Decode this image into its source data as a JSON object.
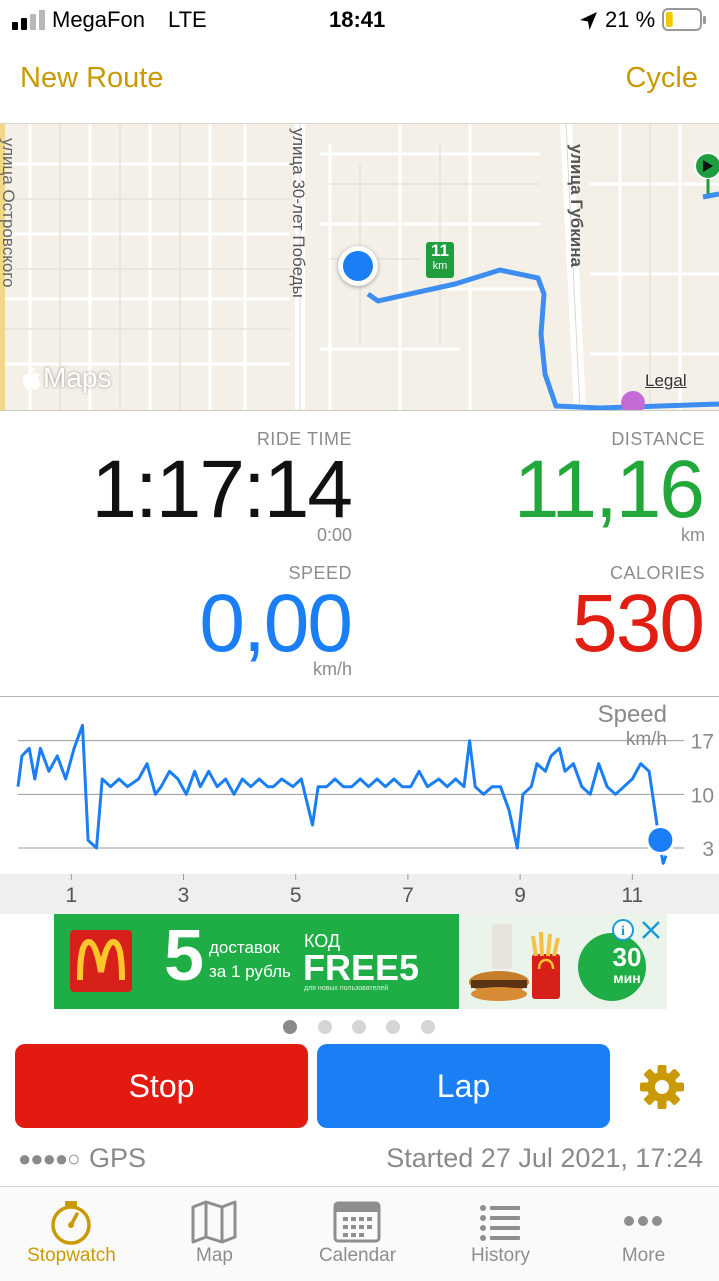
{
  "status_bar": {
    "carrier": "MegaFon",
    "network": "LTE",
    "time": "18:41",
    "battery_percent": "21 %",
    "battery_level": 0.21
  },
  "nav": {
    "left_label": "New Route",
    "right_label": "Cycle"
  },
  "map": {
    "street_labels": [
      "улица 30-лет Победы",
      "улица Губкина",
      "улица Островского"
    ],
    "km_marker": "11",
    "km_marker_unit": "km",
    "brand": "Maps",
    "legal": "Legal"
  },
  "stats": {
    "ride_time_label": "RIDE TIME",
    "ride_time_value": "1:17:14",
    "ride_time_sub": "0:00",
    "distance_label": "DISTANCE",
    "distance_value": "11,16",
    "distance_unit": "km",
    "speed_label": "SPEED",
    "speed_value": "0,00",
    "speed_unit": "km/h",
    "calories_label": "CALORIES",
    "calories_value": "530"
  },
  "chart_data": {
    "type": "line",
    "title": "Speed",
    "ylabel": "km/h",
    "yticks": [
      17,
      10,
      3
    ],
    "ylim": [
      0,
      21
    ],
    "xticks": [
      1,
      3,
      5,
      7,
      9,
      11
    ],
    "xlim": [
      0.05,
      11.85
    ],
    "grid": true,
    "series": [
      {
        "values": [
          [
            0.05,
            11
          ],
          [
            0.12,
            15
          ],
          [
            0.25,
            16
          ],
          [
            0.35,
            12
          ],
          [
            0.45,
            16
          ],
          [
            0.6,
            13
          ],
          [
            0.75,
            15
          ],
          [
            0.9,
            12
          ],
          [
            1.05,
            16
          ],
          [
            1.2,
            19
          ],
          [
            1.3,
            4
          ],
          [
            1.45,
            3
          ],
          [
            1.55,
            12
          ],
          [
            1.7,
            11
          ],
          [
            1.85,
            12
          ],
          [
            2.0,
            11
          ],
          [
            2.2,
            12
          ],
          [
            2.35,
            14
          ],
          [
            2.5,
            10
          ],
          [
            2.6,
            11
          ],
          [
            2.75,
            13
          ],
          [
            2.9,
            12
          ],
          [
            3.05,
            10
          ],
          [
            3.2,
            13
          ],
          [
            3.3,
            11
          ],
          [
            3.45,
            13
          ],
          [
            3.6,
            11
          ],
          [
            3.75,
            12
          ],
          [
            3.9,
            10
          ],
          [
            4.05,
            12
          ],
          [
            4.2,
            11
          ],
          [
            4.35,
            12
          ],
          [
            4.5,
            11
          ],
          [
            4.6,
            11
          ],
          [
            4.75,
            12
          ],
          [
            4.95,
            11
          ],
          [
            5.1,
            12
          ],
          [
            5.3,
            6
          ],
          [
            5.4,
            11
          ],
          [
            5.55,
            11
          ],
          [
            5.7,
            12
          ],
          [
            5.85,
            11
          ],
          [
            6.0,
            11
          ],
          [
            6.15,
            12
          ],
          [
            6.3,
            11
          ],
          [
            6.45,
            12
          ],
          [
            6.6,
            11
          ],
          [
            6.75,
            12
          ],
          [
            6.9,
            11
          ],
          [
            7.05,
            11
          ],
          [
            7.2,
            13
          ],
          [
            7.35,
            11
          ],
          [
            7.55,
            12
          ],
          [
            7.7,
            11
          ],
          [
            7.85,
            12
          ],
          [
            8.0,
            11
          ],
          [
            8.1,
            17
          ],
          [
            8.2,
            11
          ],
          [
            8.35,
            10
          ],
          [
            8.5,
            11
          ],
          [
            8.65,
            11
          ],
          [
            8.8,
            8
          ],
          [
            8.95,
            3
          ],
          [
            9.05,
            10
          ],
          [
            9.2,
            11
          ],
          [
            9.3,
            14
          ],
          [
            9.45,
            13
          ],
          [
            9.55,
            15
          ],
          [
            9.7,
            16
          ],
          [
            9.8,
            13
          ],
          [
            9.95,
            14
          ],
          [
            10.1,
            11
          ],
          [
            10.25,
            10
          ],
          [
            10.4,
            14
          ],
          [
            10.55,
            11
          ],
          [
            10.7,
            10
          ],
          [
            10.85,
            11
          ],
          [
            11.0,
            12
          ],
          [
            11.15,
            14
          ],
          [
            11.3,
            13
          ],
          [
            11.4,
            8
          ],
          [
            11.5,
            3
          ],
          [
            11.55,
            1
          ],
          [
            11.6,
            2
          ]
        ]
      }
    ]
  },
  "ad": {
    "big_number": "5",
    "line1": "доставок",
    "line2": "за 1 рубль",
    "code_label": "КОД",
    "code": "FREE5",
    "fine_print": "для новых пользователей",
    "badge_number": "30",
    "badge_unit": "мин"
  },
  "buttons": {
    "stop": "Stop",
    "lap": "Lap"
  },
  "footer": {
    "gps_dots": "●●●●○",
    "gps_label": "GPS",
    "started": "Started 27 Jul 2021, 17:24"
  },
  "tabs": [
    {
      "label": "Stopwatch",
      "active": true
    },
    {
      "label": "Map",
      "active": false
    },
    {
      "label": "Calendar",
      "active": false
    },
    {
      "label": "History",
      "active": false
    },
    {
      "label": "More",
      "active": false
    }
  ],
  "colors": {
    "accent": "#c99a06",
    "ride_time": "#111111",
    "distance": "#22a83a",
    "speed": "#1a7ef5",
    "calories": "#e01e12",
    "stop_button": "#e21a10",
    "lap_button": "#1a7ef5",
    "route": "#3d8ef0"
  }
}
